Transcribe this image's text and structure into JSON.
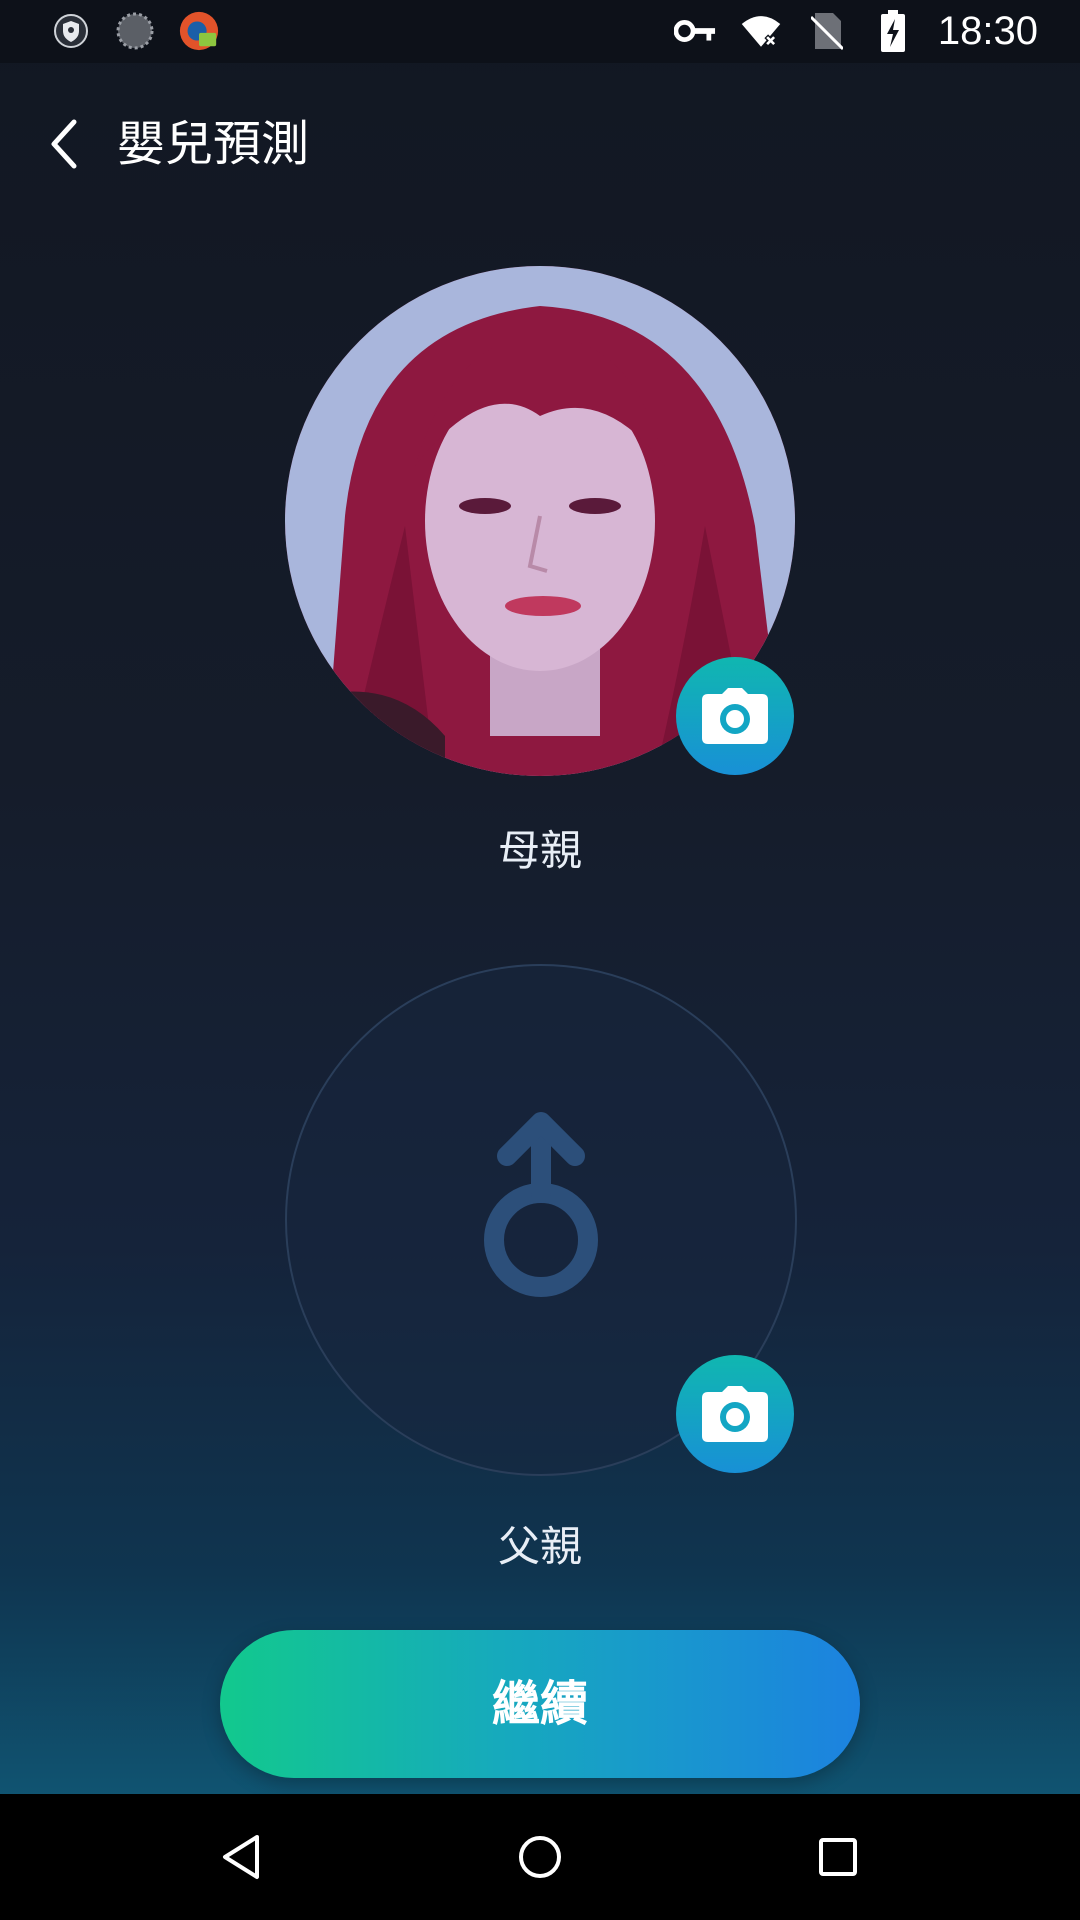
{
  "status_bar": {
    "time": "18:30",
    "left_icons": [
      "vpn-shield-icon",
      "loading-circle-icon",
      "app-notification-icon"
    ],
    "right_icons": [
      "key-icon",
      "wifi-icon",
      "no-sim-icon",
      "battery-charging-icon"
    ]
  },
  "header": {
    "title": "嬰兒預測",
    "back_icon": "chevron-left-icon"
  },
  "mother": {
    "label": "母親",
    "has_photo": true,
    "camera_icon": "camera-icon"
  },
  "father": {
    "label": "父親",
    "has_photo": false,
    "placeholder_icon": "male-symbol-icon",
    "camera_icon": "camera-icon"
  },
  "continue_button": {
    "label": "繼續"
  },
  "nav_bar": {
    "icons": [
      "back-triangle-icon",
      "home-circle-icon",
      "recents-square-icon"
    ]
  },
  "colors": {
    "accent_start": "#12c98d",
    "accent_end": "#1c82e0",
    "camera_teal": "#10b7b0",
    "background_top": "#121722",
    "background_bottom": "#106584"
  }
}
